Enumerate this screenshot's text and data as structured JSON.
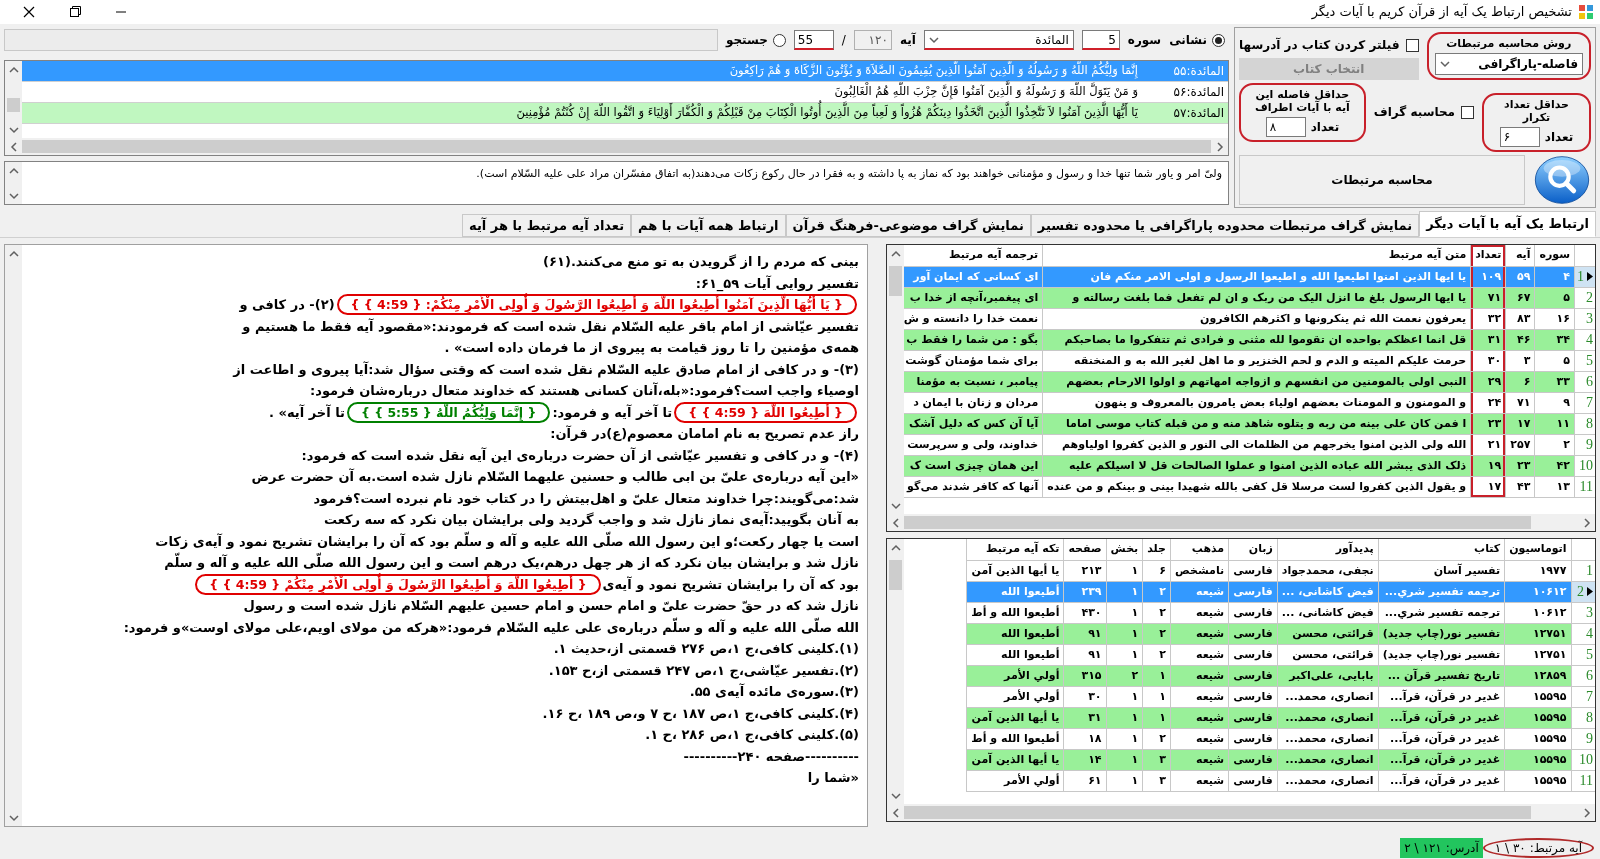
{
  "window": {
    "title": "تشخیص ارتباط یک آیه از قرآن کریم با آیات دیگر"
  },
  "locator": {
    "mode_address": {
      "label": "نشانی",
      "selected": true
    },
    "surah_label": "سوره",
    "surah_number": {
      "value": "5",
      "underlined": true
    },
    "surah_name": {
      "value": "المائدة",
      "underlined": true
    },
    "ayah_label": "آیه",
    "ayah_total": "۱۲۰",
    "separator": "/",
    "ayah_number": {
      "value": "55",
      "underlined": true
    },
    "mode_search": {
      "label": "جستجو",
      "selected": false
    }
  },
  "verse_list": {
    "rows": [
      {
        "ref": "المائدة:۵۵",
        "text": "إِنَّمَا وَلِیُّكُمُ اللّهُ وَ رَسُولُهُ وَ الَّذِینَ آمَنُوا الَّذِینَ یُقِیمُونَ الصَّلاَةَ وَ یُؤْتُونَ الزَّكَاةَ وَ هُمْ رَاكِعُونَ",
        "selected": true,
        "highlight": false
      },
      {
        "ref": "المائدة:۵۶",
        "text": "وَ مَنْ یَتَوَلَّ اللّهَ وَ رَسُولَهُ وَ الَّذِینَ آمَنُوا فَإِنَّ حِزْبَ اللّهِ هُمُ الْغَالِبُونَ",
        "selected": false,
        "highlight": false
      },
      {
        "ref": "المائدة:۵۷",
        "text": "یَا أَیُّهَا الَّذِینَ آمَنُوا لاَ تَتَّخِذُوا الَّذِینَ اتَّخَذُوا دِینَكُمْ هُزُواً وَ لَعِباً مِنَ الَّذِینَ أُوتُوا الْكِتَابَ مِنْ قَبْلِكُمْ وَ الْكُفَّارَ أَوْلِیَاءَ وَ اتَّقُوا اللّهَ إِنْ كُنْتُمْ مُؤْمِنِینَ",
        "selected": false,
        "highlight": true
      }
    ]
  },
  "translation": "ولیّ امر و یاور شما تنها خدا و رسول و مؤمنانی خواهند بود که نماز به پا داشته و به فقرا در حال رکوع زکات می‌دهند(به اتفاق مفسّران مراد علی علیه السّلام است).",
  "settings": {
    "method": {
      "title": "روش محاسبه مرتبطات",
      "value": "فاصله-پاراگرافی",
      "circled": true
    },
    "filter_books": {
      "label": "فیلتر کردن کتاب در آدرسها",
      "checked": false
    },
    "choose_books_button": {
      "label": "انتخاب کتاب",
      "disabled": true
    },
    "min_repeat": {
      "title": "حداقل تعداد تکرار",
      "field_label": "تعداد",
      "value": "۶",
      "circled": true
    },
    "compute_graph": {
      "label": "محاسبه گراف",
      "checked": false
    },
    "min_distance": {
      "title": "حداقل فاصله این آیه با آیات اطراف",
      "field_label": "تعداد",
      "value": "۸",
      "circled": true
    },
    "compute_button": {
      "label": "محاسبه مرتبطات"
    }
  },
  "tabs": [
    {
      "label": "ارتباط یک آیه با آیات دیگر",
      "selected": true
    },
    {
      "label": "نمایش گراف مرتبطات محدوده پاراگرافی یا محدوده تفسیر",
      "selected": false
    },
    {
      "label": "نمایش گراف موضوعی-فرهنگ قرآن",
      "selected": false
    },
    {
      "label": "ارتباط همه آیات با هم",
      "selected": false
    },
    {
      "label": "تعداد آیه مرتبط با هر آیه",
      "selected": false
    }
  ],
  "commentary": {
    "lines": [
      {
        "segments": [
          {
            "kind": "text",
            "text": "بینی که مردم را از گرویدن به تو منع می‌کنند.(۶۱)"
          }
        ]
      },
      {
        "segments": [
          {
            "kind": "text",
            "text": "تفسیر روایی آیات ۵۹_۶۱:"
          }
        ]
      },
      {
        "segments": [
          {
            "kind": "verse",
            "text": "{ یَا أَیُّهَا الَّذِینَ آمَنُوا أَطِیعُوا اللّهَ وَ أَطِیعُوا الرَّسُولَ وَ أُولِی الْأَمْرِ مِنْكُمْ: { 4:59 } }",
            "color": "#e00000"
          },
          {
            "kind": "text",
            "text": "(۲)- در کافی و"
          }
        ]
      },
      {
        "segments": [
          {
            "kind": "text",
            "text": "تفسیر عیّاشی از امام باقر علیه السّلام نقل شده است که فرمودند:«مقصود آیه فقط ما هستیم و"
          }
        ]
      },
      {
        "segments": [
          {
            "kind": "text",
            "text": "همه‌ی مؤمنین را تا روز قیامت به پیروی از ما فرمان داده است» ."
          }
        ]
      },
      {
        "segments": [
          {
            "kind": "text",
            "text": "(۳)- و در کافی از امام صادق علیه السّلام نقل شده است که وقتی سؤال شد:آیا پیروی و اطاعت از"
          }
        ]
      },
      {
        "segments": [
          {
            "kind": "text",
            "text": "اوصیاء واجب است؟فرمود:«بله،آنان کسانی هستند که خداوند متعال درباره‌شان فرمود:"
          }
        ]
      },
      {
        "segments": [
          {
            "kind": "verse",
            "text": "{ أَطِیعُوا اللّهَ { 4:59 } }",
            "color": "#e00000"
          },
          {
            "kind": "text",
            "text": "تا آخر آیه و فرمود:"
          },
          {
            "kind": "verse",
            "text": "{ إِنَّمَا وَلِیُّكُمُ اللّهُ { 5:55 } }",
            "color": "#008000"
          },
          {
            "kind": "text",
            "text": "تا آخر آیه» ."
          }
        ]
      },
      {
        "segments": [
          {
            "kind": "text",
            "text": "راز عدم تصریح به نام امامان معصوم(ع)در قرآن:"
          }
        ]
      },
      {
        "segments": [
          {
            "kind": "text",
            "text": "(۴)- و در کافی و تفسیر عیّاشی از آن حضرت درباره‌ی این آیه نقل شده است که فرمود:"
          }
        ]
      },
      {
        "segments": [
          {
            "kind": "text",
            "text": "«این آیه درباره‌ی علیّ بن ابی طالب و حسنین علیهما السّلام نازل شده است.به آن حضرت عرض"
          }
        ]
      },
      {
        "segments": [
          {
            "kind": "text",
            "text": "شد:می‌گویند:چرا خداوند متعال علیّ و اهل‌بیتش را در کتاب خود نام نبرده است؟فرمود"
          }
        ]
      },
      {
        "segments": [
          {
            "kind": "text",
            "text": "به آنان بگویید:آیه‌ی نماز نازل شد و واجب گردید ولی برایشان بیان نکرد که سه رکعت"
          }
        ]
      },
      {
        "segments": [
          {
            "kind": "text",
            "text": "است یا چهار رکعت؛و این رسول الله صلّی الله علیه و آله و سلّم بود که آن را برایشان تشریح نمود و آیه‌ی زکات"
          }
        ]
      },
      {
        "segments": [
          {
            "kind": "text",
            "text": "نازل شد و برایشان بیان نکرد که از هر چهل درهم،یک درهم است و این رسول الله صلّی الله علیه و آله و سلّم"
          }
        ]
      },
      {
        "segments": [
          {
            "kind": "text",
            "text": "بود که آن را برایشان تشریح نمود و آیه‌ی"
          },
          {
            "kind": "verse",
            "text": "{ أَطِیعُوا اللّهَ وَ أَطِیعُوا الرَّسُولَ وَ أُولِی الْأَمْرِ مِنْكُمْ { 4:59 } }",
            "color": "#e00000"
          }
        ]
      },
      {
        "segments": [
          {
            "kind": "text",
            "text": "نازل شد که در حقّ حضرت علیّ و امام حسن و امام حسین علیهم السّلام نازل شده است و رسول"
          }
        ]
      },
      {
        "segments": [
          {
            "kind": "text",
            "text": "الله صلّی الله علیه و آله و سلّم درباره‌ی علی علیه السّلام فرمود:«هرکه من مولای اویم،علی مولای اوست»و فرمود:"
          }
        ]
      },
      {
        "segments": [
          {
            "kind": "text",
            "text": "(۱).کلینی کافی،ج ۱،ص ۲۷۶ قسمتی از،حدیث ۱."
          }
        ]
      },
      {
        "segments": [
          {
            "kind": "text",
            "text": "(۲).تفسیر عیّاشی،ج ۱،ص ۲۴۷ قسمتی از،ح ۱۵۳."
          }
        ]
      },
      {
        "segments": [
          {
            "kind": "text",
            "text": "(۳).سوره‌ی مائده آیه‌ی ۵۵."
          }
        ]
      },
      {
        "segments": [
          {
            "kind": "text",
            "text": "(۴).کلینی کافی،ج ۱،ص ۱۸۷ ،ح ۷ و،ص ۱۸۹ ،ح ۱۶."
          }
        ]
      },
      {
        "segments": [
          {
            "kind": "text",
            "text": "(۵).کلینی کافی،ج ۱،ص ۲۸۶ ،ح ۱."
          }
        ]
      },
      {
        "segments": [
          {
            "kind": "text",
            "text": "----------صفحه ۲۴۰----------"
          }
        ]
      },
      {
        "segments": [
          {
            "kind": "text",
            "text": "«شما را"
          }
        ]
      }
    ]
  },
  "related_ayahs": {
    "columns": [
      {
        "label": "سوره",
        "circled": false
      },
      {
        "label": "آیه",
        "circled": false
      },
      {
        "label": "تعداد",
        "circled": true
      },
      {
        "label": "متن آیه مرتبط",
        "circled": false
      },
      {
        "label": "ترجمه آیه مرتبط",
        "circled": false
      }
    ],
    "rows": [
      {
        "number": "1",
        "selected": true,
        "highlight": false,
        "cells": [
          "۴",
          "۵۹",
          "۱۰۹",
          "یا ایها الذین امنوا اطیعوا الله و اطیعوا الرسول و اولی الامر منکم فان",
          "ای کسانی که ایمان آور"
        ]
      },
      {
        "number": "2",
        "selected": false,
        "highlight": true,
        "cells": [
          "۵",
          "۶۷",
          "۷۱",
          "یا ایها الرسول بلغ ما انزل الیک من ربک و ان لم تفعل فما بلغت رسالته و",
          "ای پیغمبر،آنچه از خدا ب"
        ]
      },
      {
        "number": "3",
        "selected": false,
        "highlight": false,
        "cells": [
          "۱۶",
          "۸۳",
          "۳۲",
          "یعرفون نعمت الله ثم ینکرونها و اکثرهم الکافرون",
          "نعمت خدا را دانسته و ش"
        ]
      },
      {
        "number": "4",
        "selected": false,
        "highlight": true,
        "cells": [
          "۳۴",
          "۴۶",
          "۳۱",
          "قل انما اعظکم بواحده ان تقوموا لله مثنی و فرادی ثم تتفکروا ما بصاحبکم",
          "بگو : من شما را فقط ب"
        ]
      },
      {
        "number": "5",
        "selected": false,
        "highlight": false,
        "cells": [
          "۵",
          "۳",
          "۳۰",
          "حرمت علیکم المیته و الدم و لحم الخنزیر و ما اهل لغیر الله به و المنخنقه",
          "برای شما مؤمنان گوشت"
        ]
      },
      {
        "number": "6",
        "selected": false,
        "highlight": true,
        "cells": [
          "۳۳",
          "۶",
          "۲۹",
          "النبی اولی بالمومنین من انفسهم و ازواجه امهاتهم و اولوا الارحام بعضهم",
          "پیامبر ، نسبت به مؤمنا"
        ]
      },
      {
        "number": "7",
        "selected": false,
        "highlight": false,
        "cells": [
          "۹",
          "۷۱",
          "۲۴",
          "و المومنون و المومنات بعضهم اولیاء بعض یامرون بالمعروف و ینهون",
          "مردان و زنان با ایمان د"
        ]
      },
      {
        "number": "8",
        "selected": false,
        "highlight": true,
        "cells": [
          "۱۱",
          "۱۷",
          "۲۳",
          "ا فمن کان علی بینه من ربه و یتلوه شاهد منه و من قبله کتاب موسی اماما",
          "آیا آن کس که دلیل آشک"
        ]
      },
      {
        "number": "9",
        "selected": false,
        "highlight": false,
        "cells": [
          "۲",
          "۲۵۷",
          "۲۱",
          "الله ولی الذین امنوا یخرجهم من الظلمات الی النور و الذین کفروا اولیاوهم",
          "خداوند، ولی و سرپرست"
        ]
      },
      {
        "number": "10",
        "selected": false,
        "highlight": true,
        "cells": [
          "۴۲",
          "۲۳",
          "۱۹",
          "ذلک الذی یبشر الله عباده الذین امنوا و عملوا الصالحات قل لا اسیلکم علیه",
          "این همان چیزی است ک"
        ]
      },
      {
        "number": "11",
        "selected": false,
        "highlight": false,
        "cells": [
          "۱۳",
          "۴۳",
          "۱۷",
          "و یقول الذین کفروا لست مرسلا قل کفی بالله شهیدا بینی و بینکم و من عنده",
          "آنها که کافر شدند می‌گو"
        ]
      }
    ]
  },
  "sources": {
    "columns": [
      {
        "label": "اتوماسیون",
        "circled": false
      },
      {
        "label": "کتاب",
        "circled": false
      },
      {
        "label": "پدیدآور",
        "circled": false
      },
      {
        "label": "زبان",
        "circled": false
      },
      {
        "label": "مذهب",
        "circled": false
      },
      {
        "label": "جلد",
        "circled": false
      },
      {
        "label": "بخش",
        "circled": false
      },
      {
        "label": "صفحه",
        "circled": false
      },
      {
        "label": "تکه آیه مرتبط",
        "circled": false
      }
    ],
    "rows": [
      {
        "number": "1",
        "selected": false,
        "highlight": false,
        "cells": [
          "۱۹۷۷",
          "تفسیر آسان",
          "نجفی، محمدجواد",
          "فارسی",
          "نامشخص",
          "۶",
          "۱",
          "۲۱۳",
          "یا أیها الذین آمن"
        ]
      },
      {
        "number": "2",
        "selected": true,
        "highlight": false,
        "cells": [
          "۱۰۶۱۲",
          "ترجمه تفسیر شري...",
          "فیض کاشانی، ...",
          "فارسی",
          "شیعه",
          "۲",
          "۱",
          "۲۳۹",
          "أطیعوا الله"
        ]
      },
      {
        "number": "3",
        "selected": false,
        "highlight": false,
        "cells": [
          "۱۰۶۱۲",
          "ترجمه تفسیر شري...",
          "فیض کاشانی، ...",
          "فارسی",
          "شیعه",
          "۲",
          "۱",
          "۴۳۰",
          "أطیعوا الله و أط"
        ]
      },
      {
        "number": "4",
        "selected": false,
        "highlight": true,
        "cells": [
          "۱۲۷۵۱",
          "تفسیر نور(چاپ جدید)",
          "قرائتی، محسن",
          "فارسی",
          "شیعه",
          "۲",
          "۱",
          "۹۱",
          "أطیعوا الله"
        ]
      },
      {
        "number": "5",
        "selected": false,
        "highlight": false,
        "cells": [
          "۱۲۷۵۱",
          "تفسیر نور(چاپ جدید)",
          "قرائتی، محسن",
          "فارسی",
          "شیعه",
          "۲",
          "۱",
          "۹۱",
          "أطیعوا الله"
        ]
      },
      {
        "number": "6",
        "selected": false,
        "highlight": true,
        "cells": [
          "۱۲۸۵۹",
          "تاریخ تفسیر قرآن ...",
          "بابایی، علی‌اکبر",
          "فارسی",
          "شیعه",
          "۱",
          "۲",
          "۳۱۵",
          "أولي الأمر"
        ]
      },
      {
        "number": "7",
        "selected": false,
        "highlight": false,
        "cells": [
          "۱۵۵۹۵",
          "غدیر در قرآن، قرآ...",
          "انصاری، محمد...",
          "فارسی",
          "شیعه",
          "۱",
          "۱",
          "۳۰",
          "أولي الأمر"
        ]
      },
      {
        "number": "8",
        "selected": false,
        "highlight": true,
        "cells": [
          "۱۵۵۹۵",
          "غدیر در قرآن، قرآ...",
          "انصاری، محمد...",
          "فارسی",
          "شیعه",
          "۱",
          "۱",
          "۳۱",
          "یا أیها الذین آمن"
        ]
      },
      {
        "number": "9",
        "selected": false,
        "highlight": false,
        "cells": [
          "۱۵۵۹۵",
          "غدیر در قرآن، قرآ...",
          "انصاری، محمد...",
          "فارسی",
          "شیعه",
          "۲",
          "۱",
          "۱۸",
          "أطیعوا الله و أط"
        ]
      },
      {
        "number": "10",
        "selected": false,
        "highlight": true,
        "cells": [
          "۱۵۵۹۵",
          "غدیر در قرآن، قرآ...",
          "انصاری، محمد...",
          "فارسی",
          "شیعه",
          "۳",
          "۱",
          "۱۴",
          "یا أیها الذین آمن"
        ]
      },
      {
        "number": "11",
        "selected": false,
        "highlight": false,
        "cells": [
          "۱۵۵۹۵",
          "غدیر در قرآن، قرآ...",
          "انصاری، محمد...",
          "فارسی",
          "شیعه",
          "۳",
          "۱",
          "۶۱",
          "أولي الأمر"
        ]
      }
    ]
  },
  "status_bar": [
    {
      "text": "آیه مرتبط: ۳۰ \\ ۱",
      "highlight": false,
      "circled": true
    },
    {
      "text": "آدرس: ۱۲۱ \\ ۲",
      "highlight": true,
      "circled": false
    }
  ]
}
